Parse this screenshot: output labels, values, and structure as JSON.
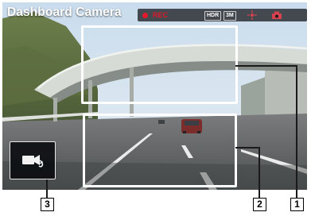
{
  "app": {
    "title": "Dashboard Camera"
  },
  "status_bar": {
    "rec_label": "REC",
    "rec_color": "#e0192b",
    "hdr_label": "HDR",
    "resolution_label": "3M",
    "icons": [
      "gps-icon",
      "camera-icon"
    ]
  },
  "controls": {
    "camera_switch": {
      "icon": "camera-switch-icon"
    }
  },
  "callouts": {
    "info_area": "1",
    "video_area": "2",
    "camera_switch": "3"
  }
}
